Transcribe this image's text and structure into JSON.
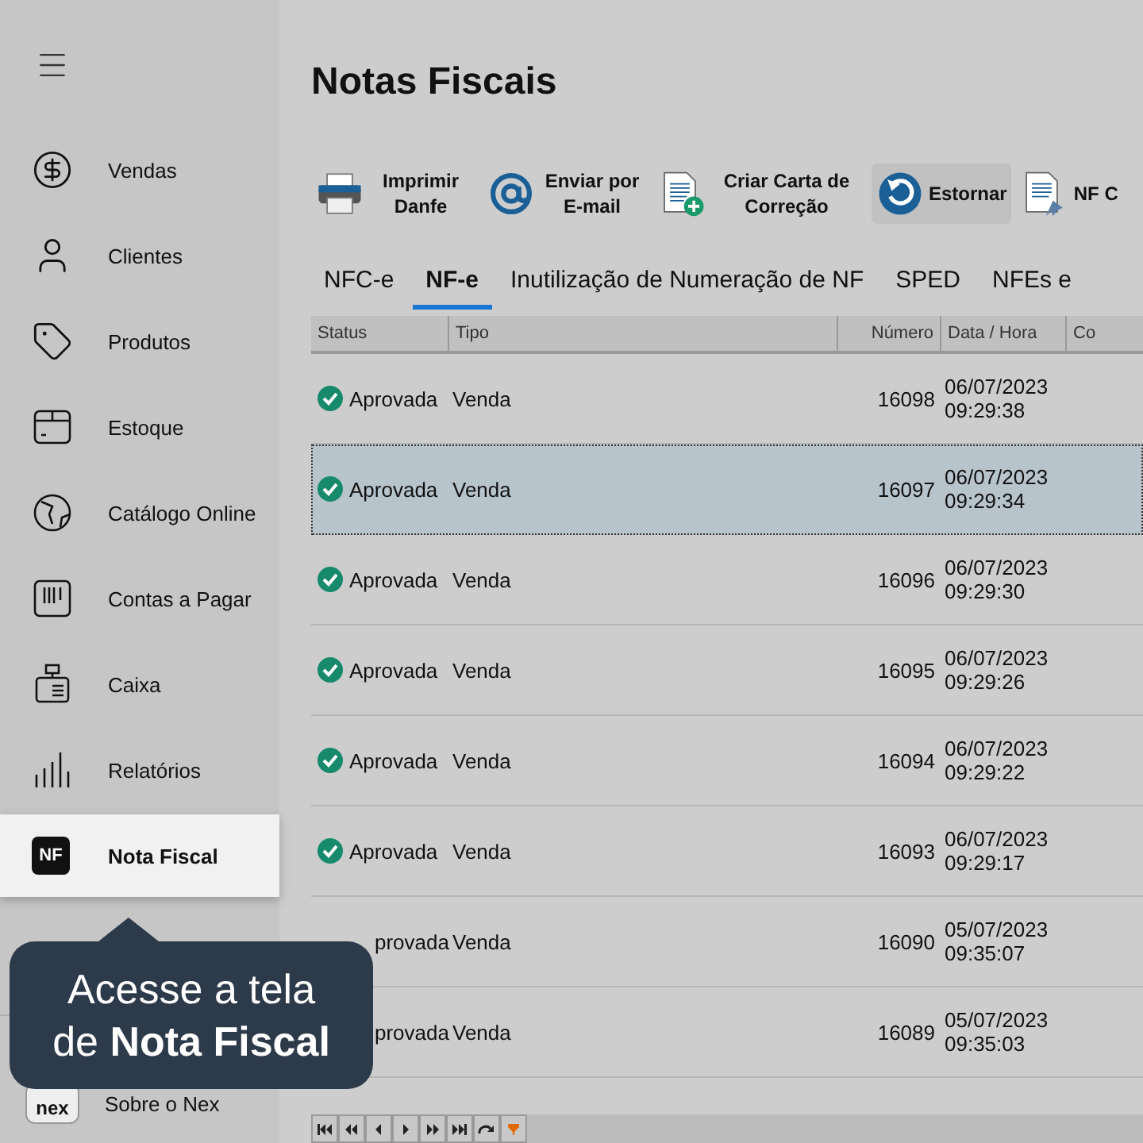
{
  "sidebar": {
    "items": [
      {
        "label": "Vendas",
        "kind": "dollar",
        "selected": false
      },
      {
        "label": "Clientes",
        "kind": "person",
        "selected": false
      },
      {
        "label": "Produtos",
        "kind": "tag",
        "selected": false
      },
      {
        "label": "Estoque",
        "kind": "box",
        "selected": false
      },
      {
        "label": "Catálogo Online",
        "kind": "globe",
        "selected": false
      },
      {
        "label": "Contas a Pagar",
        "kind": "barcode",
        "selected": false
      },
      {
        "label": "Caixa",
        "kind": "register",
        "selected": false
      },
      {
        "label": "Relatórios",
        "kind": "bars",
        "selected": false
      },
      {
        "label": "Nota Fiscal",
        "kind": "badge",
        "badge": "NF",
        "selected": true
      }
    ],
    "footer_item": {
      "label": "Sobre o Nex",
      "logo_text": "nex"
    }
  },
  "tooltip": {
    "lines": [
      "Acesse a tela",
      "de **Nota Fiscal**"
    ]
  },
  "page": {
    "title": "Notas Fiscais"
  },
  "toolbar": [
    {
      "label": "Imprimir Danfe",
      "kind": "printer",
      "selected": false
    },
    {
      "label": "Enviar por E-mail",
      "kind": "at",
      "selected": false
    },
    {
      "label": "Criar Carta de Correção",
      "kind": "doc-plus",
      "selected": false
    },
    {
      "label": "Estornar",
      "kind": "undo",
      "selected": true
    },
    {
      "label": "NF C",
      "kind": "doc-pin",
      "selected": false
    }
  ],
  "tabs": [
    {
      "label": "NFC-e",
      "selected": false
    },
    {
      "label": "NF-e",
      "selected": true
    },
    {
      "label": "Inutilização de Numeração de NF",
      "selected": false
    },
    {
      "label": "SPED",
      "selected": false
    },
    {
      "label": "NFEs e",
      "selected": false
    }
  ],
  "table": {
    "columns": [
      "Status",
      "Tipo",
      "Número",
      "Data / Hora",
      "Co"
    ],
    "rows": [
      {
        "status": "Aprovada",
        "status_icon": true,
        "type": "Venda",
        "number": "16098",
        "date": "06/07/2023",
        "time": "09:29:38",
        "selected": false
      },
      {
        "status": "Aprovada",
        "status_icon": true,
        "type": "Venda",
        "number": "16097",
        "date": "06/07/2023",
        "time": "09:29:34",
        "selected": true
      },
      {
        "status": "Aprovada",
        "status_icon": true,
        "type": "Venda",
        "number": "16096",
        "date": "06/07/2023",
        "time": "09:29:30",
        "selected": false
      },
      {
        "status": "Aprovada",
        "status_icon": true,
        "type": "Venda",
        "number": "16095",
        "date": "06/07/2023",
        "time": "09:29:26",
        "selected": false
      },
      {
        "status": "Aprovada",
        "status_icon": true,
        "type": "Venda",
        "number": "16094",
        "date": "06/07/2023",
        "time": "09:29:22",
        "selected": false
      },
      {
        "status": "Aprovada",
        "status_icon": true,
        "type": "Venda",
        "number": "16093",
        "date": "06/07/2023",
        "time": "09:29:17",
        "selected": false
      },
      {
        "status": "provada",
        "status_icon": false,
        "type": "Venda",
        "number": "16090",
        "date": "05/07/2023",
        "time": "09:35:07",
        "selected": false
      },
      {
        "status": "provada",
        "status_icon": false,
        "type": "Venda",
        "number": "16089",
        "date": "05/07/2023",
        "time": "09:35:03",
        "selected": false
      }
    ]
  },
  "navigator": [
    {
      "kind": "first"
    },
    {
      "kind": "prev-page"
    },
    {
      "kind": "prev"
    },
    {
      "kind": "next"
    },
    {
      "kind": "next-page"
    },
    {
      "kind": "last"
    },
    {
      "kind": "refresh"
    },
    {
      "kind": "filter"
    }
  ]
}
